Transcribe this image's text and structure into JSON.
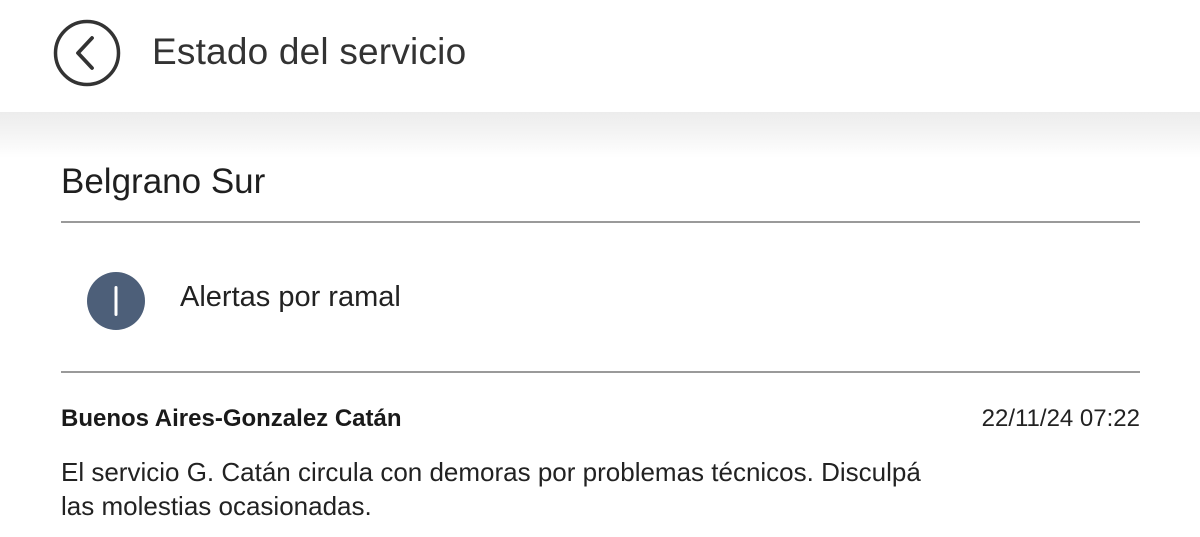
{
  "header": {
    "title": "Estado del servicio",
    "back_icon": "chevron-left-circle-icon"
  },
  "line": {
    "name": "Belgrano Sur"
  },
  "alerts_row": {
    "icon": "info-icon",
    "label": "Alertas por ramal"
  },
  "alert": {
    "route": "Buenos Aires-Gonzalez Catán",
    "timestamp": "22/11/24 07:22",
    "message_line1": "El servicio G. Catán circula con demoras por problemas técnicos. Disculpá",
    "message_line2": "las molestias ocasionadas."
  },
  "colors": {
    "icon_circle": "#4d5f79",
    "divider": "#9a9a9a",
    "text": "#222222"
  }
}
